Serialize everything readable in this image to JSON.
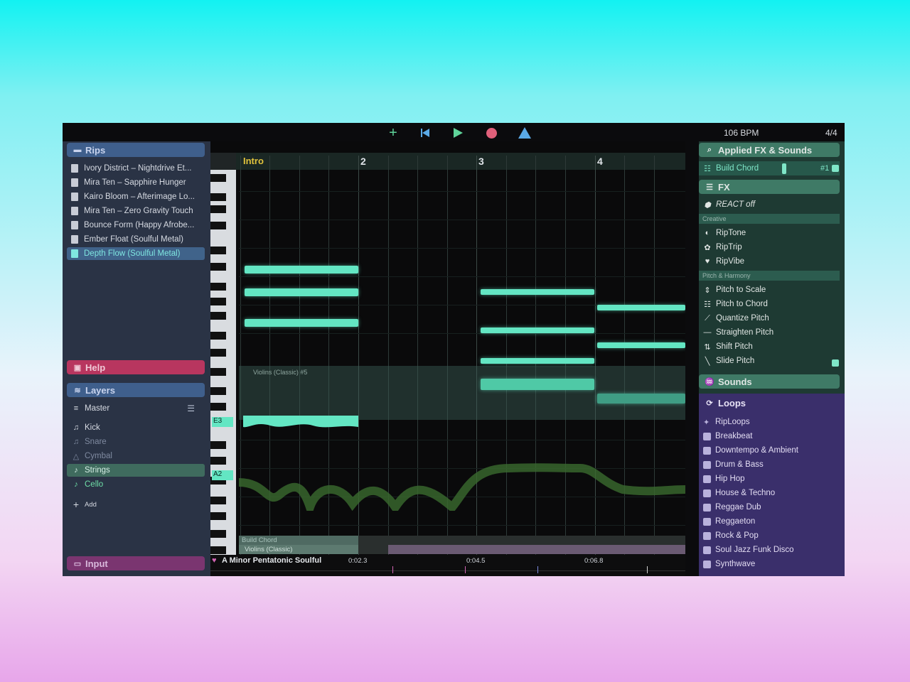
{
  "transport": {
    "add_icon": "plus-icon",
    "rewind_icon": "skip-back-icon",
    "play_icon": "play-icon",
    "record_icon": "record-icon",
    "metronome_icon": "triangle-icon",
    "tempo": "106 BPM",
    "time_signature": "4/4"
  },
  "left": {
    "rips_title": "Rips",
    "rips": [
      "Ivory District – Nightdrive Et...",
      "Mira Ten – Sapphire Hunger",
      "Kairo Bloom – Afterimage Lo...",
      "Mira Ten – Zero Gravity Touch",
      "Bounce Form (Happy Afrobe...",
      "Ember Float (Soulful Metal)",
      "Depth Flow (Soulful Metal)"
    ],
    "help_title": "Help",
    "layers_title": "Layers",
    "master_label": "Master",
    "layers": [
      "Kick",
      "Snare",
      "Cymbal",
      "Strings",
      "Cello"
    ],
    "add_label": "Add",
    "input_title": "Input"
  },
  "timeline": {
    "bars": [
      "Intro",
      "2",
      "3",
      "4"
    ],
    "key_labels": [
      "E3",
      "A2"
    ],
    "region_label": "Violins (Classic) #5",
    "track_labels": [
      "Build Chord",
      "Violins (Classic)"
    ],
    "scale_label": "A Minor Pentatonic Soulful",
    "times": [
      "0:02.3",
      "0:04.5",
      "0:06.8"
    ]
  },
  "right": {
    "applied_title": "Applied FX & Sounds",
    "applied_item": "Build Chord",
    "applied_index": "#1",
    "fx_title": "FX",
    "react_label": "REACT off",
    "creative_label": "Creative",
    "creative": [
      "RipTone",
      "RipTrip",
      "RipVibe"
    ],
    "pitch_label": "Pitch & Harmony",
    "pitch": [
      "Pitch to Scale",
      "Pitch to Chord",
      "Quantize Pitch",
      "Straighten Pitch",
      "Shift Pitch",
      "Slide Pitch"
    ],
    "sounds_title": "Sounds",
    "loops_title": "Loops",
    "loops": [
      "RipLoops",
      "Breakbeat",
      "Downtempo & Ambient",
      "Drum & Bass",
      "Hip Hop",
      "House & Techno",
      "Reggae Dub",
      "Reggaeton",
      "Rock & Pop",
      "Soul Jazz Funk Disco",
      "Synthwave"
    ]
  },
  "colors": {
    "accent": "#63e6c3",
    "play": "#5fd49a",
    "record": "#e0607a",
    "metronome": "#5aa9e6",
    "rips_header": "#3f5f8c",
    "help_header": "#b8365f",
    "loops_panel": "#3a2f6b"
  }
}
